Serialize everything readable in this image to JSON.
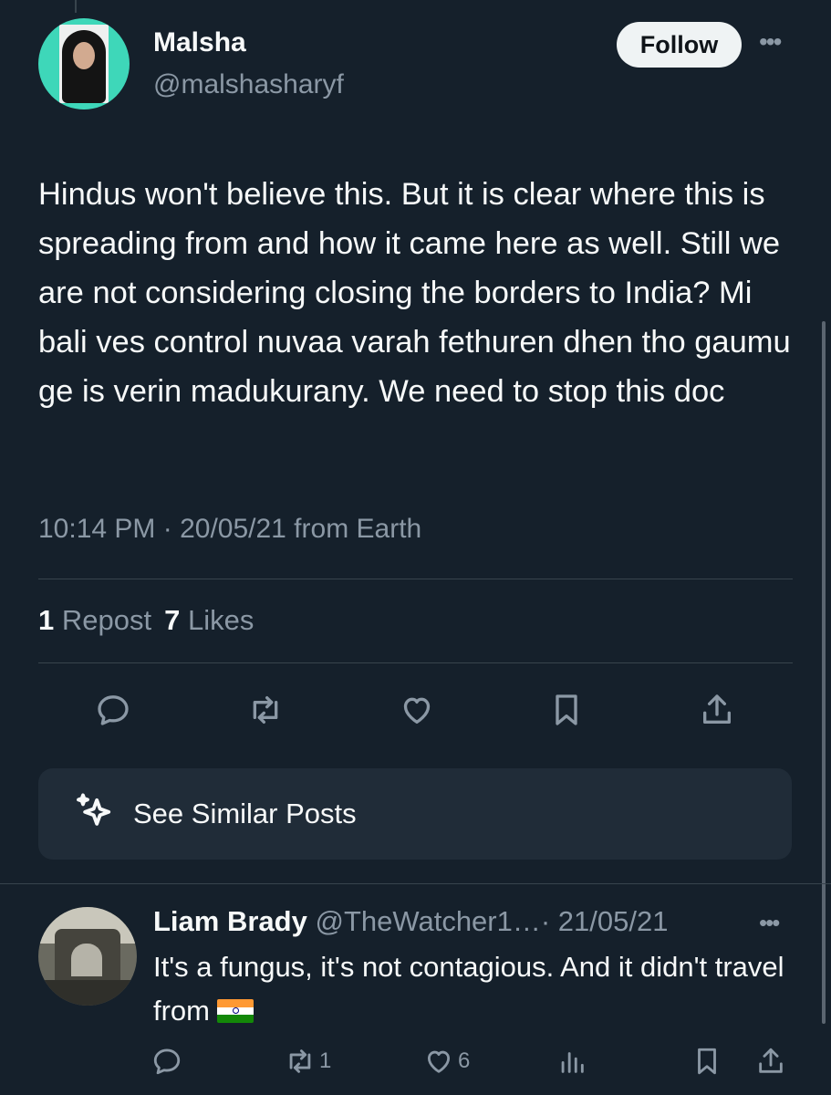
{
  "author": {
    "name": "Malsha",
    "handle": "@malshasharyf",
    "follow_label": "Follow",
    "avatar_color": "#3ed7b9"
  },
  "tweet": {
    "text": "Hindus won't believe this. But it is clear where this is spreading from and how it came here as well. Still we are not considering closing the borders to India? Mi bali ves control nuvaa varah fethuren dhen tho gaumu ge is verin madukurany. We need to stop this doc",
    "meta": "10:14 PM · 20/05/21 from Earth"
  },
  "stats": {
    "reposts_count": "1",
    "reposts_label": "Repost",
    "likes_count": "7",
    "likes_label": "Likes"
  },
  "actions": {
    "icons": [
      "reply-icon",
      "repost-icon",
      "like-icon",
      "bookmark-icon",
      "share-icon"
    ]
  },
  "similar": {
    "label": "See Similar Posts",
    "icon": "sparkle-icon"
  },
  "reply": {
    "name": "Liam Brady",
    "handle": "@TheWatcher1…",
    "date": "· 21/05/21",
    "text": "It's a fungus, it's not contagious. And it didn't travel from",
    "flag": "india-flag-icon",
    "repost_count": "1",
    "like_count": "6"
  },
  "colors": {
    "background": "#15202b",
    "text": "#f7f9f9",
    "secondary": "#8b98a5",
    "card": "#202c38"
  }
}
